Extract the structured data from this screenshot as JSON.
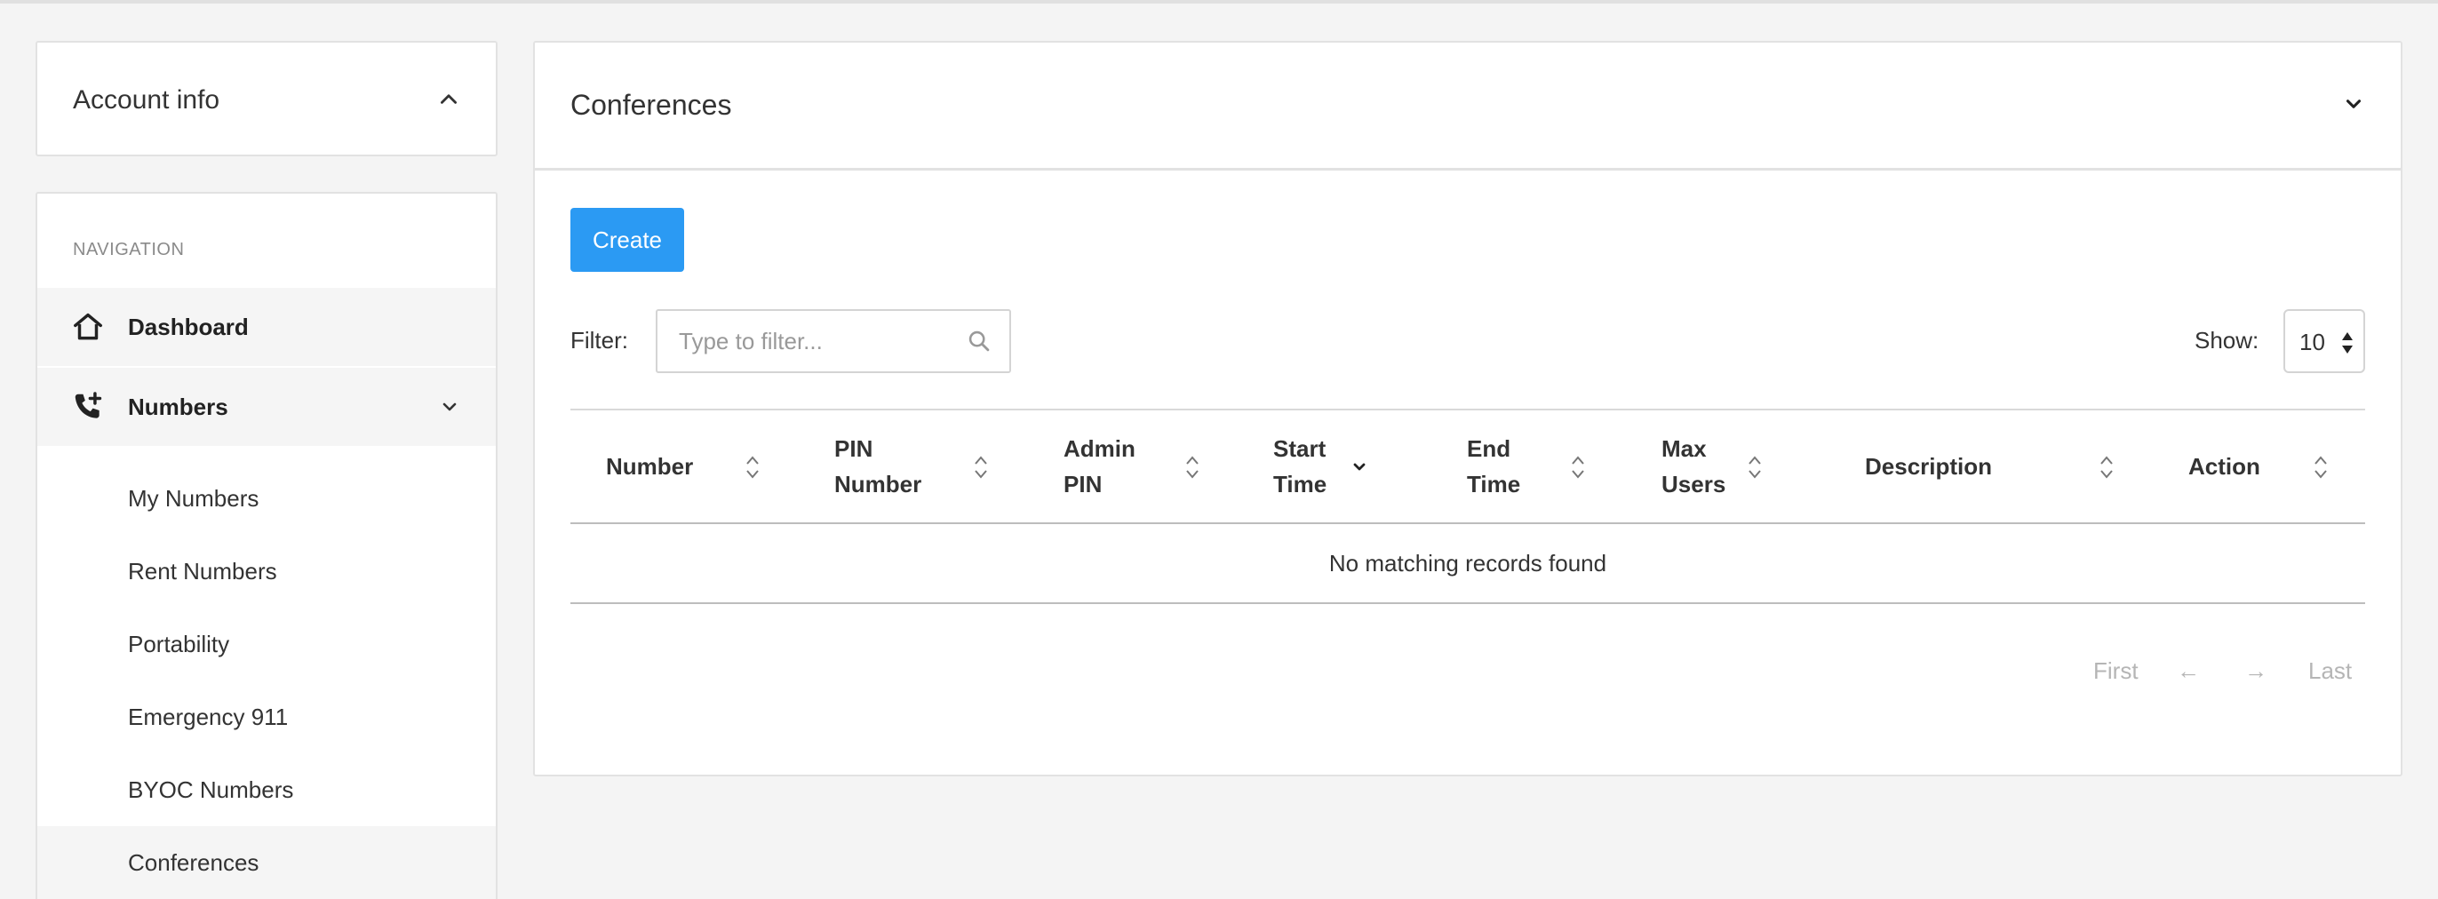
{
  "sidebar": {
    "account_title": "Account info",
    "nav_heading": "NAVIGATION",
    "items": [
      {
        "label": "Dashboard",
        "icon": "home-icon"
      },
      {
        "label": "Numbers",
        "icon": "phone-plus-icon"
      }
    ],
    "sub_items": [
      {
        "label": "My Numbers"
      },
      {
        "label": "Rent Numbers"
      },
      {
        "label": "Portability"
      },
      {
        "label": "Emergency 911"
      },
      {
        "label": "BYOC Numbers"
      },
      {
        "label": "Conferences"
      }
    ]
  },
  "main": {
    "title": "Conferences",
    "create_label": "Create",
    "filter_label": "Filter:",
    "filter_placeholder": "Type to filter...",
    "show_label": "Show:",
    "show_value": "10",
    "columns": [
      {
        "label": "Number",
        "sort": "both"
      },
      {
        "label": "PIN Number",
        "sort": "both"
      },
      {
        "label": "Admin PIN",
        "sort": "both"
      },
      {
        "label": "Start Time",
        "sort": "desc"
      },
      {
        "label": "End Time",
        "sort": "both"
      },
      {
        "label": "Max Users",
        "sort": "both"
      },
      {
        "label": "Description",
        "sort": "both"
      },
      {
        "label": "Action",
        "sort": "both"
      }
    ],
    "empty_message": "No matching records found",
    "pagination": {
      "first": "First",
      "prev": "←",
      "next": "→",
      "last": "Last"
    }
  },
  "colors": {
    "accent": "#2b9af3",
    "background": "#f4f4f4"
  }
}
